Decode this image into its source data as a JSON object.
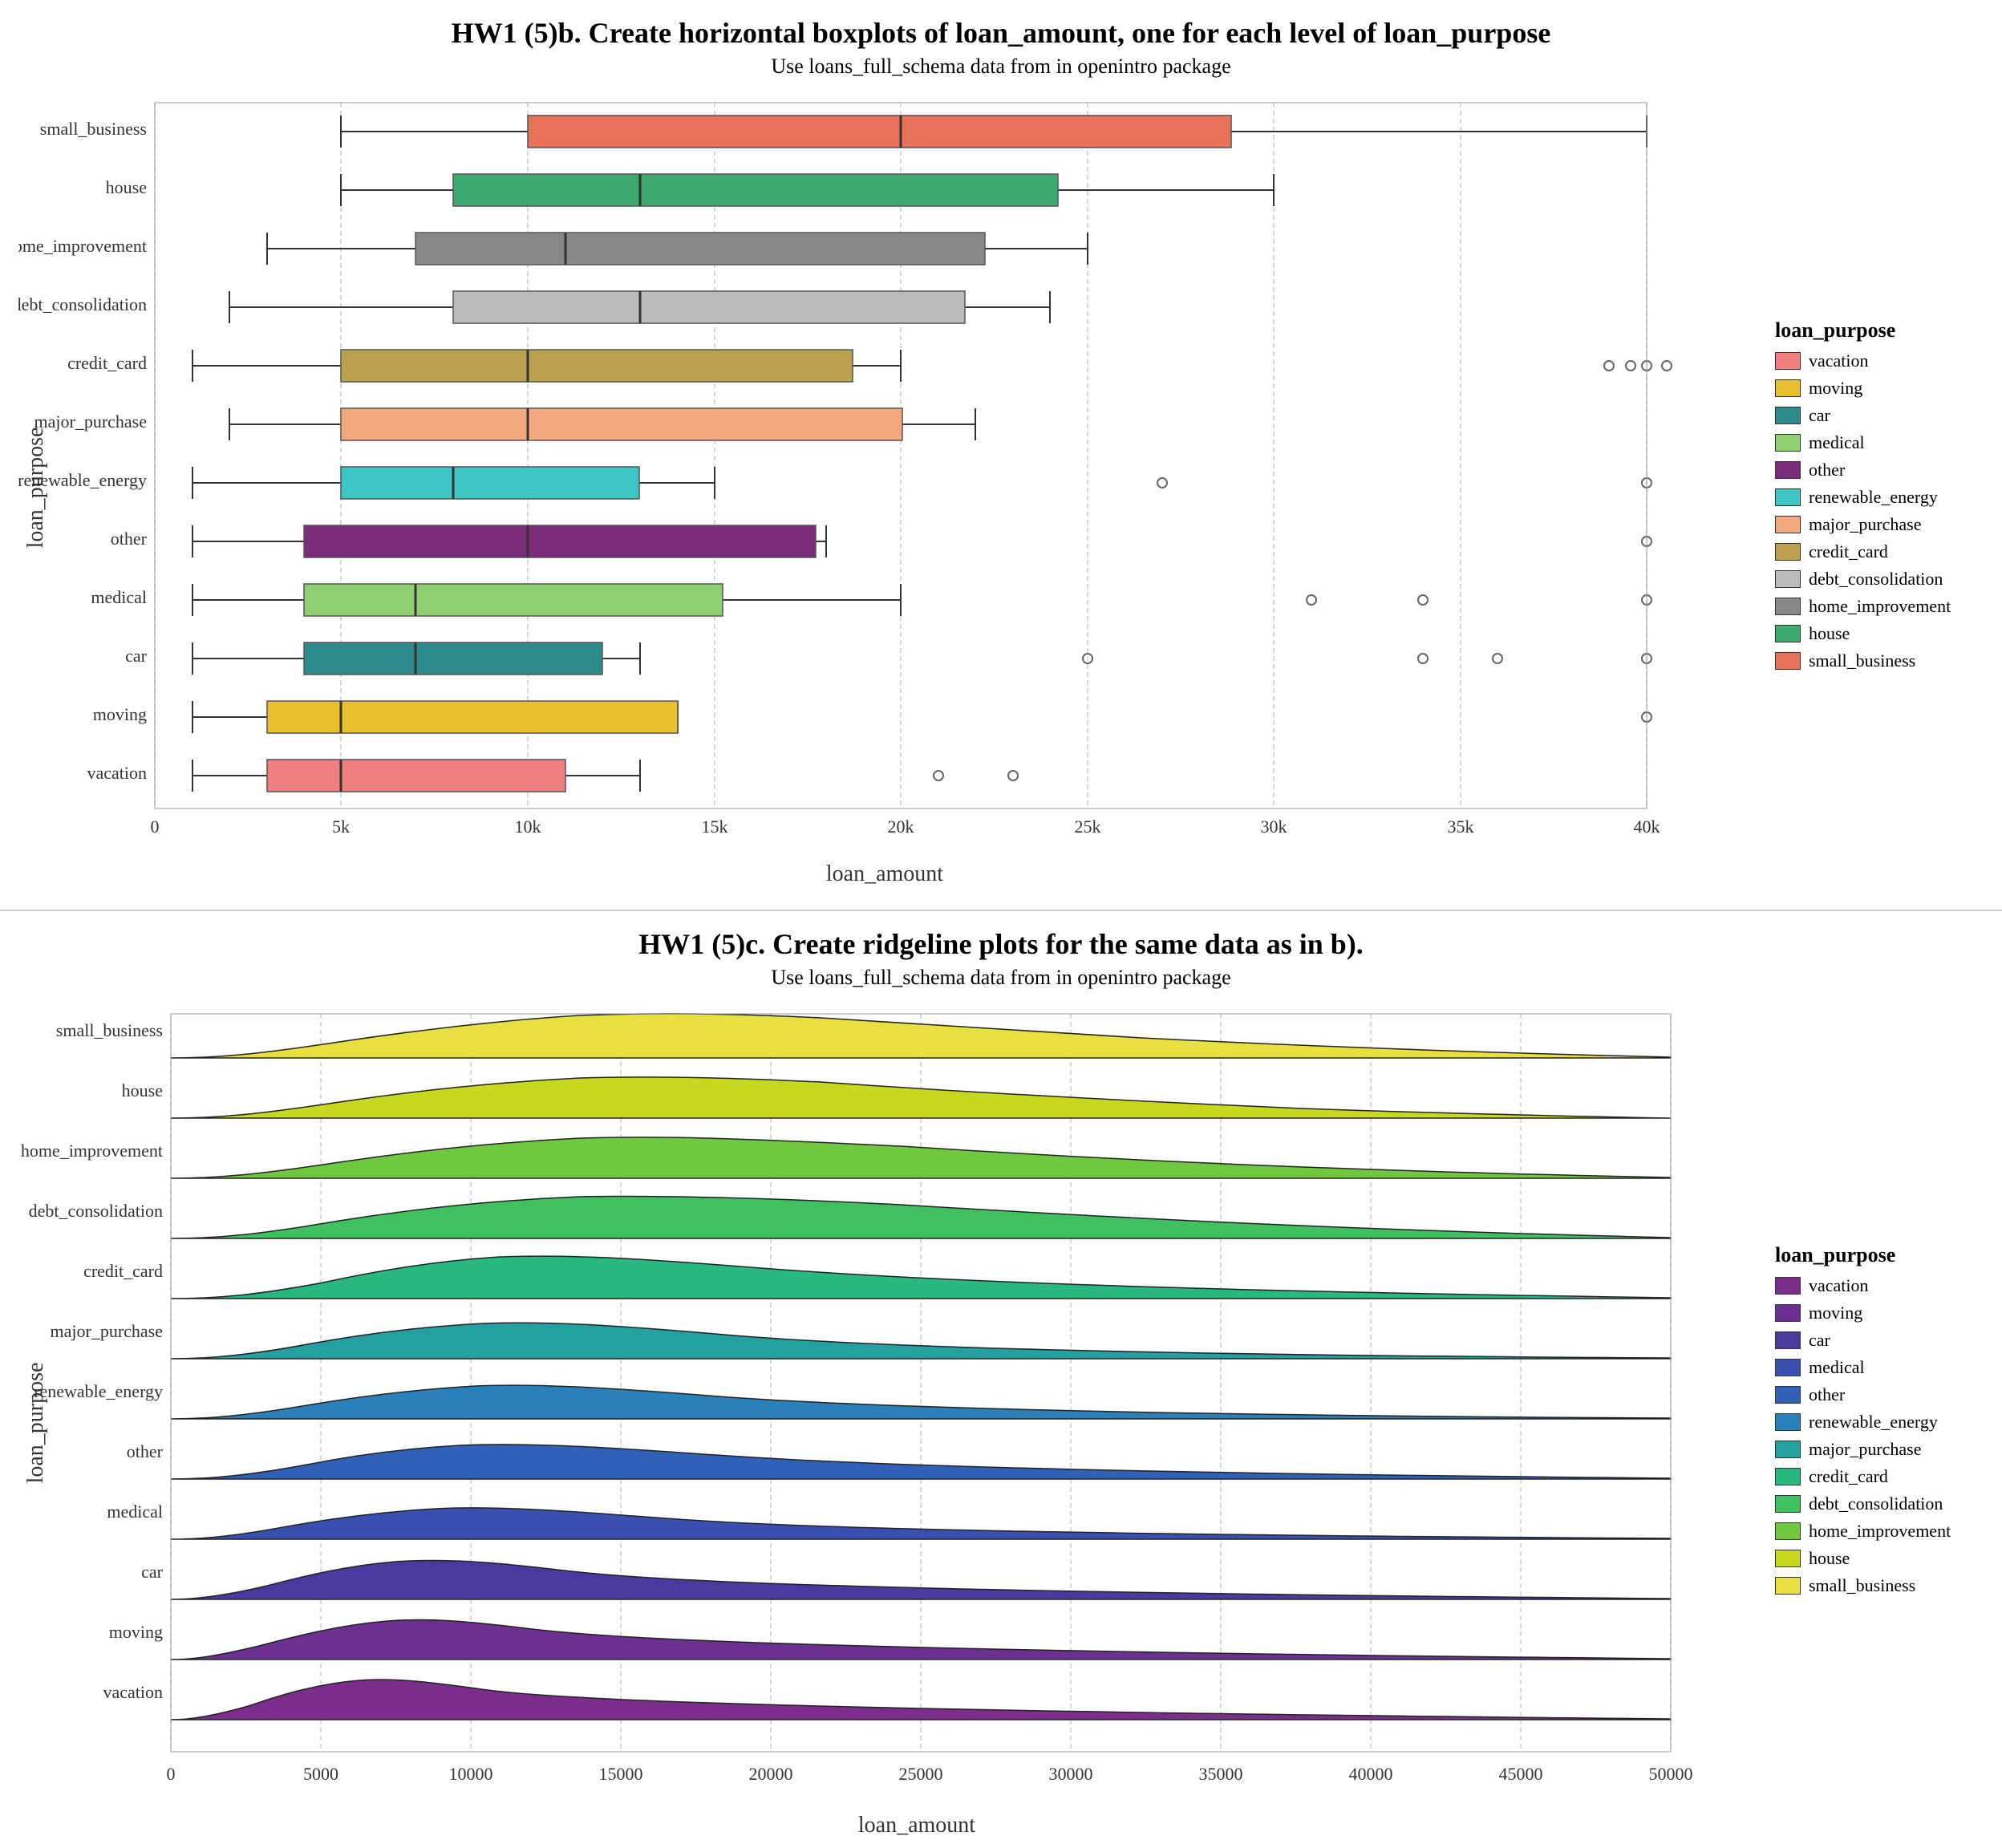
{
  "charts": {
    "boxplot": {
      "title": "HW1 (5)b. Create horizontal boxplots of loan_amount, one for each level of loan_purpose",
      "subtitle": "Use loans_full_schema data from in openintro package",
      "xlabel": "loan_amount",
      "ylabel": "loan_purpose",
      "categories": [
        "small_business",
        "house",
        "home_improvement",
        "debt_consolidation",
        "credit_card",
        "major_purchase",
        "renewable_energy",
        "other",
        "medical",
        "car",
        "moving",
        "vacation"
      ],
      "colors": {
        "small_business": "#E8735A",
        "house": "#3DAA6E",
        "home_improvement": "#888888",
        "debt_consolidation": "#AAAAAA",
        "credit_card": "#BBA050",
        "major_purchase": "#F4A880",
        "renewable_energy": "#40C5C5",
        "other": "#7B2D7B",
        "medical": "#90D070",
        "car": "#2D8B8B",
        "moving": "#E8C030",
        "vacation": "#F08080"
      },
      "xaxis": [
        "0",
        "5k",
        "10k",
        "15k",
        "20k",
        "25k",
        "30k",
        "35k",
        "40k"
      ]
    },
    "ridgeline": {
      "title": "HW1 (5)c. Create ridgeline plots for the same data as in b).",
      "subtitle": "Use loans_full_schema data from in openintro package",
      "xlabel": "loan_amount",
      "ylabel": "loan_purpose",
      "categories": [
        "small_business",
        "house",
        "home_improvement",
        "debt_consolidation",
        "credit_card",
        "major_purchase",
        "renewable_energy",
        "other",
        "medical",
        "car",
        "moving",
        "vacation"
      ],
      "xaxis": [
        "0",
        "5000",
        "10000",
        "15000",
        "20000",
        "25000",
        "30000",
        "35000",
        "40000",
        "45000",
        "50000"
      ]
    }
  },
  "legend_boxplot": {
    "title": "loan_purpose",
    "items": [
      {
        "label": "vacation",
        "color": "#F08080"
      },
      {
        "label": "moving",
        "color": "#E8C030"
      },
      {
        "label": "car",
        "color": "#2D8B8B"
      },
      {
        "label": "medical",
        "color": "#90D070"
      },
      {
        "label": "other",
        "color": "#7B2D7B"
      },
      {
        "label": "renewable_energy",
        "color": "#40C5C5"
      },
      {
        "label": "major_purchase",
        "color": "#F4A880"
      },
      {
        "label": "credit_card",
        "color": "#BBA050"
      },
      {
        "label": "debt_consolidation",
        "color": "#AAAAAA"
      },
      {
        "label": "home_improvement",
        "color": "#888888"
      },
      {
        "label": "house",
        "color": "#3DAA6E"
      },
      {
        "label": "small_business",
        "color": "#E8735A"
      }
    ]
  },
  "legend_ridgeline": {
    "title": "loan_purpose",
    "items": [
      {
        "label": "vacation",
        "color": "#7B2D8B"
      },
      {
        "label": "moving",
        "color": "#6B3090"
      },
      {
        "label": "car",
        "color": "#4A3AA0"
      },
      {
        "label": "medical",
        "color": "#3A50B0"
      },
      {
        "label": "other",
        "color": "#3060B8"
      },
      {
        "label": "renewable_energy",
        "color": "#2A80B8"
      },
      {
        "label": "major_purchase",
        "color": "#25A0A0"
      },
      {
        "label": "credit_card",
        "color": "#28B880"
      },
      {
        "label": "debt_consolidation",
        "color": "#40C060"
      },
      {
        "label": "home_improvement",
        "color": "#70C840"
      },
      {
        "label": "house",
        "color": "#C8D820"
      },
      {
        "label": "small_business",
        "color": "#E8E040"
      }
    ]
  }
}
